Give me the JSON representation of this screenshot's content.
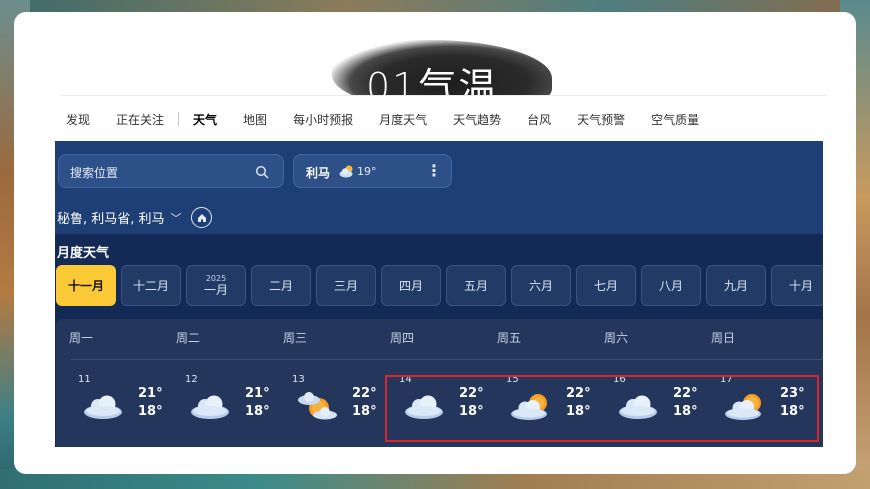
{
  "slide": {
    "title": "01气温"
  },
  "nav": {
    "items": [
      {
        "label": "发现"
      },
      {
        "label": "正在关注"
      },
      {
        "label": "天气",
        "active": true
      },
      {
        "label": "地图"
      },
      {
        "label": "每小时预报"
      },
      {
        "label": "月度天气"
      },
      {
        "label": "天气趋势"
      },
      {
        "label": "台风"
      },
      {
        "label": "天气预警"
      },
      {
        "label": "空气质量"
      }
    ]
  },
  "search": {
    "placeholder": "搜索位置"
  },
  "location_chip": {
    "name": "利马",
    "icon": "partly-cloudy-icon",
    "temp": "19°"
  },
  "breadcrumb": {
    "location": "秘鲁, 利马省, 利马"
  },
  "monthly": {
    "title": "月度天气",
    "months": [
      {
        "label": "十一月",
        "active": true
      },
      {
        "label": "十二月"
      },
      {
        "year": "2025",
        "label": "一月"
      },
      {
        "label": "二月"
      },
      {
        "label": "三月"
      },
      {
        "label": "四月"
      },
      {
        "label": "五月"
      },
      {
        "label": "六月"
      },
      {
        "label": "七月"
      },
      {
        "label": "八月"
      },
      {
        "label": "九月"
      },
      {
        "label": "十月"
      }
    ],
    "weekdays": [
      "周一",
      "周二",
      "周三",
      "周四",
      "周五",
      "周六",
      "周日"
    ],
    "days": [
      {
        "date": "11",
        "icon": "cloudy-icon",
        "high": "21°",
        "low": "18°"
      },
      {
        "date": "12",
        "icon": "cloudy-icon",
        "high": "21°",
        "low": "18°"
      },
      {
        "date": "13",
        "icon": "partly-sunny-icon",
        "high": "22°",
        "low": "18°"
      },
      {
        "date": "14",
        "icon": "cloudy-icon",
        "high": "22°",
        "low": "18°"
      },
      {
        "date": "15",
        "icon": "partly-sunny-icon",
        "high": "22°",
        "low": "18°"
      },
      {
        "date": "16",
        "icon": "cloudy-icon",
        "high": "22°",
        "low": "18°"
      },
      {
        "date": "17",
        "icon": "partly-sunny-icon",
        "high": "23°",
        "low": "18°"
      }
    ]
  },
  "colors": {
    "app_bg": "#1d3f75",
    "panel_bg": "#122a55",
    "active_month": "#fcc936",
    "highlight_box": "#d8262c"
  }
}
